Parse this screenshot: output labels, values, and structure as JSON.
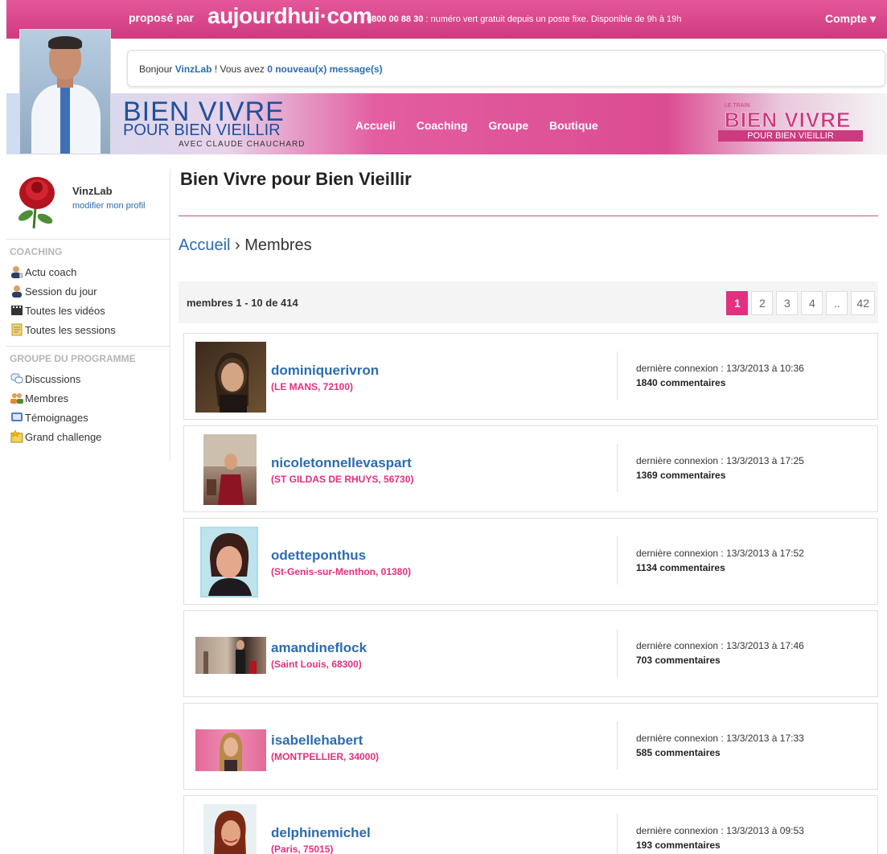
{
  "topbar": {
    "propose": "proposé par",
    "logo": "aujourdhui·com",
    "phone_number": "0800 00 88 30",
    "phone_text": " : numéro vert gratuit depuis un poste fixe. Disponible de 9h à 19h",
    "account": "Compte ▾"
  },
  "greeting": {
    "hello": "Bonjour ",
    "username": "VinzLab",
    "middle": " ! Vous avez ",
    "messages": "0 nouveau(x) message(s)"
  },
  "banner": {
    "title_line1": "BIEN VIVRE",
    "title_line2": "POUR BIEN VIEILLIR",
    "title_line3": "AVEC CLAUDE CHAUCHARD",
    "nav": [
      "Accueil",
      "Coaching",
      "Groupe",
      "Boutique"
    ],
    "train_small": "LE TRAIN",
    "train_big": "BIEN VIVRE",
    "train_strip": "POUR BIEN VIEILLIR"
  },
  "sidebar": {
    "username": "VinzLab",
    "edit_profile": "modifier mon profil",
    "coaching_title": "COACHING",
    "coaching_items": [
      {
        "label": "Actu coach",
        "icon": "coach-icon"
      },
      {
        "label": "Session du jour",
        "icon": "user-icon"
      },
      {
        "label": "Toutes les vidéos",
        "icon": "film-icon"
      },
      {
        "label": "Toutes les sessions",
        "icon": "document-icon"
      }
    ],
    "group_title": "GROUPE DU PROGRAMME",
    "group_items": [
      {
        "label": "Discussions",
        "icon": "chat-icon"
      },
      {
        "label": "Membres",
        "icon": "members-icon"
      },
      {
        "label": "Témoignages",
        "icon": "testimony-icon"
      },
      {
        "label": "Grand challenge",
        "icon": "challenge-icon"
      }
    ]
  },
  "main": {
    "title": "Bien Vivre pour Bien Vieillir",
    "breadcrumb_home": "Accueil",
    "breadcrumb_sep": " › ",
    "breadcrumb_current": "Membres",
    "count": "membres 1 - 10 de 414",
    "pages": [
      "1",
      "2",
      "3",
      "4",
      "..",
      "42"
    ],
    "active_page": "1"
  },
  "members": [
    {
      "name": "dominiquerivron",
      "location": "(LE MANS, 72100)",
      "last_login": "dernière connexion : 13/3/2013 à 10:36",
      "comments": "1840 commentaires"
    },
    {
      "name": "nicoletonnellevaspart",
      "location": "(ST GILDAS DE RHUYS, 56730)",
      "last_login": "dernière connexion : 13/3/2013 à 17:25",
      "comments": "1369 commentaires"
    },
    {
      "name": "odetteponthus",
      "location": "(St-Genis-sur-Menthon, 01380)",
      "last_login": "dernière connexion : 13/3/2013 à 17:52",
      "comments": "1134 commentaires"
    },
    {
      "name": "amandineflock",
      "location": "(Saint Louis, 68300)",
      "last_login": "dernière connexion : 13/3/2013 à 17:46",
      "comments": "703 commentaires"
    },
    {
      "name": "isabellehabert",
      "location": "(MONTPELLIER, 34000)",
      "last_login": "dernière connexion : 13/3/2013 à 17:33",
      "comments": "585 commentaires"
    },
    {
      "name": "delphinemichel",
      "location": "(Paris, 75015)",
      "last_login": "dernière connexion : 13/3/2013 à 09:53",
      "comments": "193 commentaires"
    }
  ],
  "colors": {
    "pink": "#e2307f",
    "link_blue": "#2b6cb0",
    "brand_blue": "#1f4f9c"
  }
}
